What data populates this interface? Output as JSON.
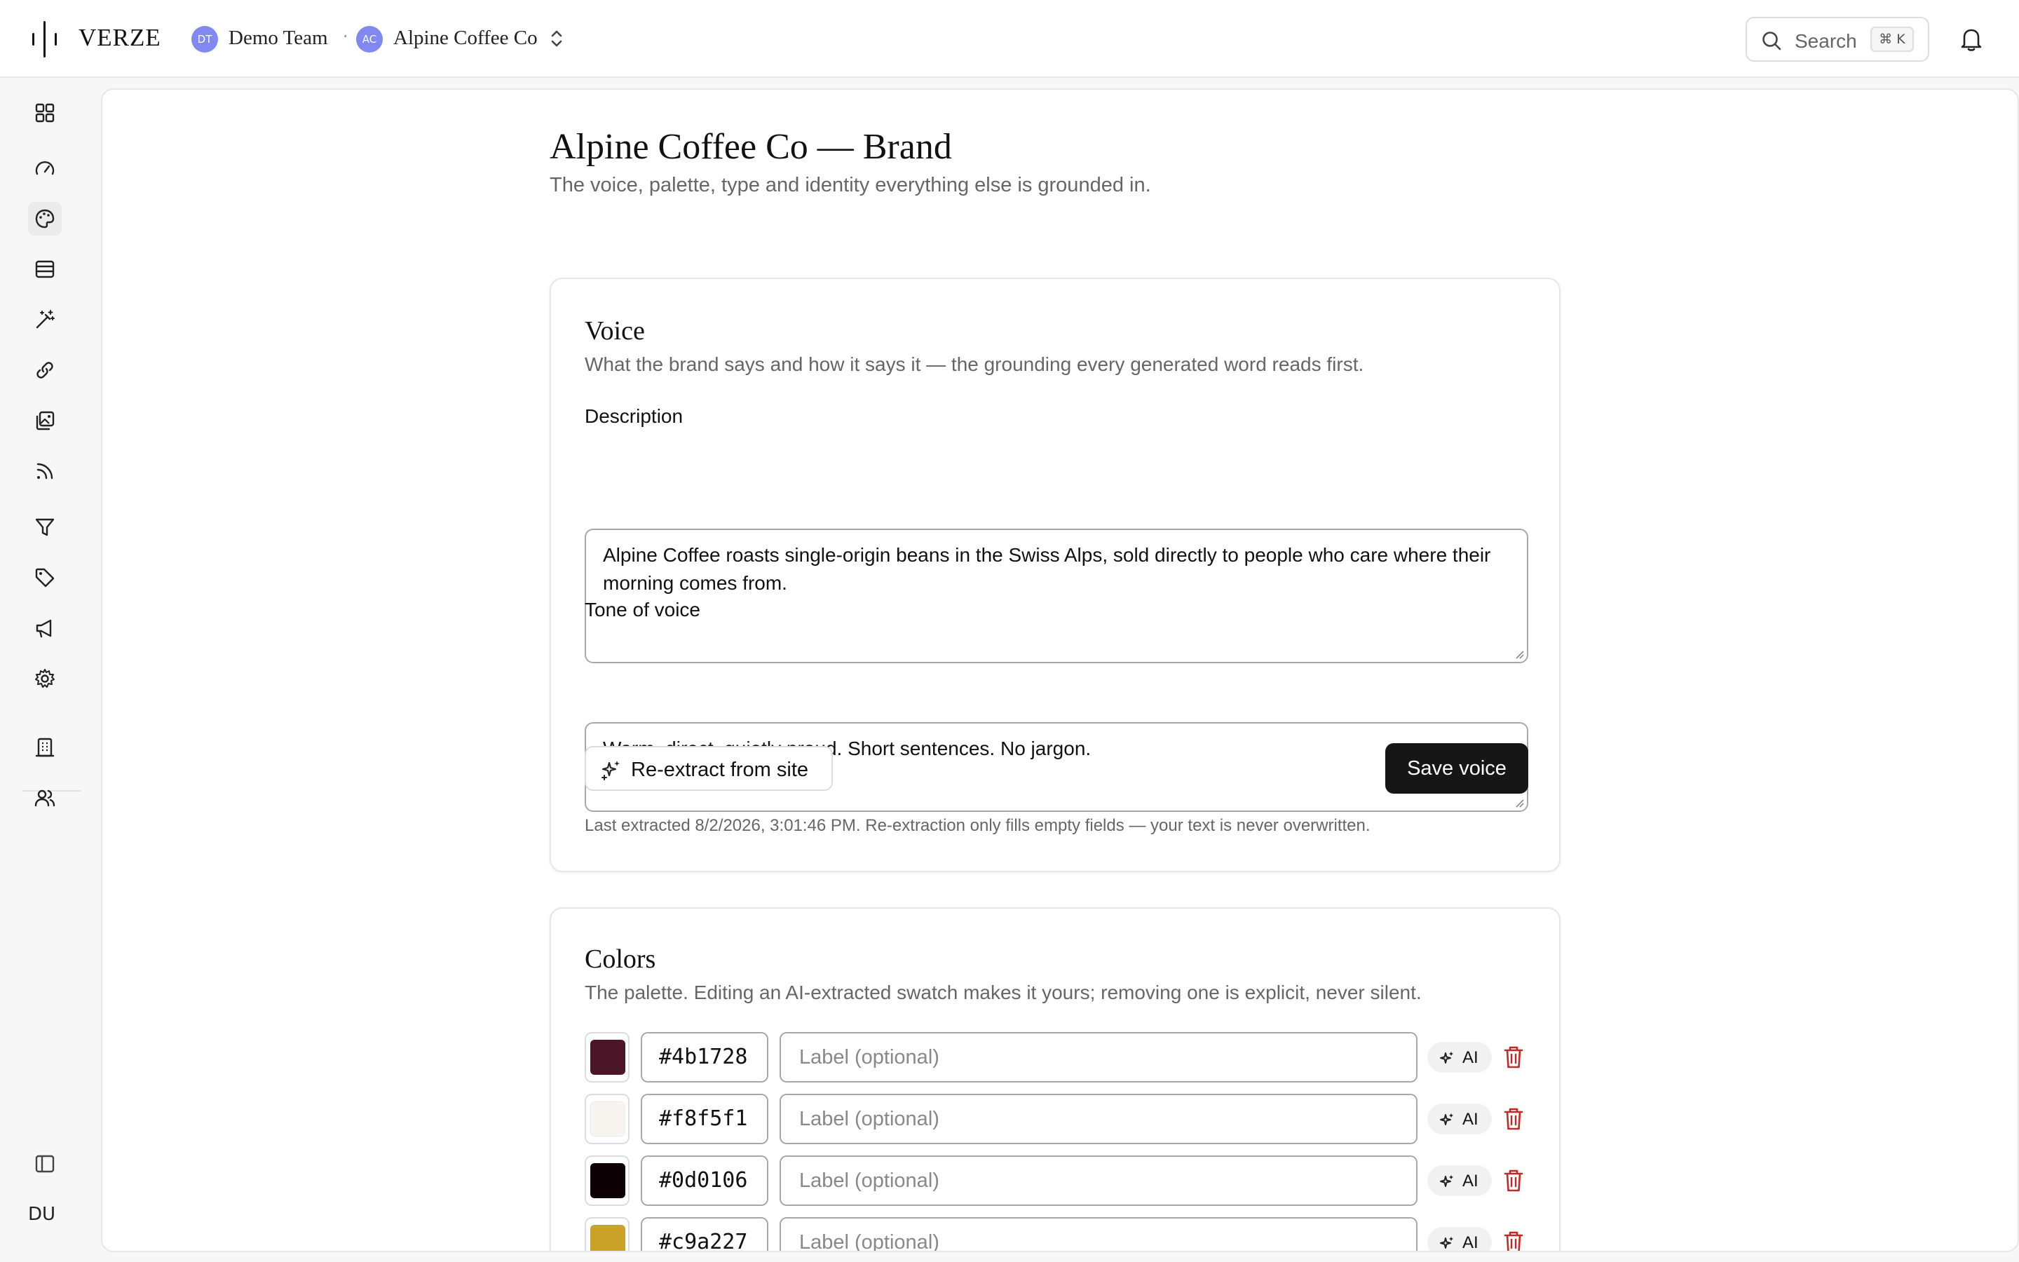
{
  "app": {
    "logo_text": "VERZE",
    "team": {
      "avatar": "DT",
      "name": "Demo Team"
    },
    "separator": "·",
    "brand": {
      "avatar": "AC",
      "name": "Alpine Coffee Co"
    },
    "search": {
      "label": "Search",
      "shortcut": "⌘ K"
    }
  },
  "sidebar": {
    "items": [
      "dashboard",
      "analytics",
      "brand",
      "content",
      "generate",
      "links",
      "media",
      "feeds",
      "filters",
      "tags",
      "campaigns",
      "settings",
      "organization",
      "team"
    ],
    "active": "brand",
    "user_initials": "DU"
  },
  "page": {
    "title": "Alpine Coffee Co — Brand",
    "subtitle": "The voice, palette, type and identity everything else is grounded in."
  },
  "voice": {
    "title": "Voice",
    "subtitle": "What the brand says and how it says it — the grounding every generated word reads first.",
    "description_label": "Description",
    "description_value": "Alpine Coffee roasts single-origin beans in the Swiss Alps, sold directly to people who care where their morning comes from.",
    "tone_label": "Tone of voice",
    "tone_value": "Warm, direct, quietly proud. Short sentences. No jargon.",
    "reextract_label": "Re-extract from site",
    "save_label": "Save voice",
    "footnote": "Last extracted 8/2/2026, 3:01:46 PM. Re-extraction only fills empty fields — your text is never overwritten."
  },
  "colors": {
    "title": "Colors",
    "subtitle": "The palette. Editing an AI-extracted swatch makes it yours; removing one is explicit, never silent.",
    "label_placeholder": "Label (optional)",
    "ai_badge": "AI",
    "swatches": [
      {
        "hex": "#4b1728"
      },
      {
        "hex": "#f8f5f1"
      },
      {
        "hex": "#0d0106"
      },
      {
        "hex": "#c9a227"
      }
    ]
  }
}
